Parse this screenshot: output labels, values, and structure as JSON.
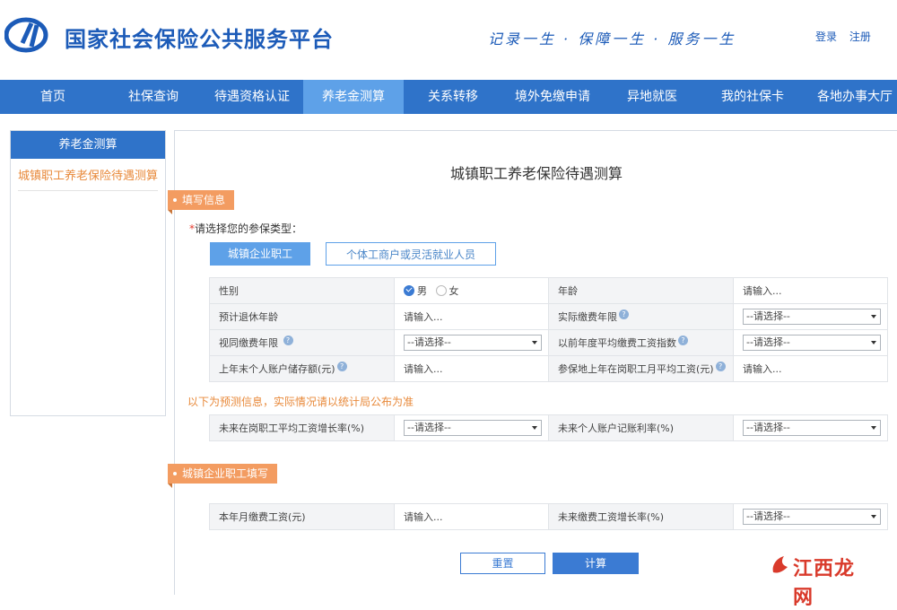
{
  "header": {
    "site_title": "国家社会保险公共服务平台",
    "slogan": "记录一生 · 保障一生 · 服务一生",
    "login": "登录",
    "register": "注册"
  },
  "nav": {
    "items": [
      "首页",
      "社保查询",
      "待遇资格认证",
      "养老金测算",
      "关系转移",
      "境外免缴申请",
      "异地就医",
      "我的社保卡",
      "各地办事大厅"
    ],
    "active": "养老金测算"
  },
  "sidebar": {
    "heading": "养老金测算",
    "link": "城镇职工养老保险待遇测算"
  },
  "main": {
    "title": "城镇职工养老保险待遇测算",
    "section_fill": "填写信息",
    "type_prompt": "请选择您的参保类型：",
    "type_options": [
      "城镇企业职工",
      "个体工商户或灵活就业人员"
    ],
    "form": {
      "gender_label": "性别",
      "gender_male": "男",
      "gender_female": "女",
      "age_label": "年龄",
      "age_placeholder": "请输入...",
      "retire_age_label": "预计退休年龄",
      "retire_age_placeholder": "请输入...",
      "actual_years_label": "实际缴费年限",
      "actual_years_value": "--请选择--",
      "deemed_years_label": "视同缴费年限",
      "deemed_years_value": "--请选择--",
      "avg_index_label": "以前年度平均缴费工资指数",
      "avg_index_value": "--请选择--",
      "account_balance_label": "上年末个人账户储存额(元)",
      "account_balance_placeholder": "请输入...",
      "avg_wage_label": "参保地上年在岗职工月平均工资(元)",
      "avg_wage_placeholder": "请输入..."
    },
    "forecast_note": "以下为预测信息，实际情况请以统计局公布为准",
    "forecast": {
      "wage_growth_label": "未来在岗职工平均工资增长率(%)",
      "wage_growth_value": "--请选择--",
      "interest_label": "未来个人账户记账利率(%)",
      "interest_value": "--请选择--"
    },
    "section_enterprise": "城镇企业职工填写",
    "enterprise": {
      "monthly_wage_label": "本年月缴费工资(元)",
      "monthly_wage_placeholder": "请输入...",
      "future_growth_label": "未来缴费工资增长率(%)",
      "future_growth_value": "--请选择--"
    },
    "reset_label": "重置",
    "calc_label": "计算"
  },
  "watermark": {
    "text": "江西龙网"
  },
  "colors": {
    "brand_blue": "#2f73c9",
    "nav_active": "#5ea1e8",
    "accent_orange": "#f39c61",
    "note_orange": "#e8893a"
  }
}
